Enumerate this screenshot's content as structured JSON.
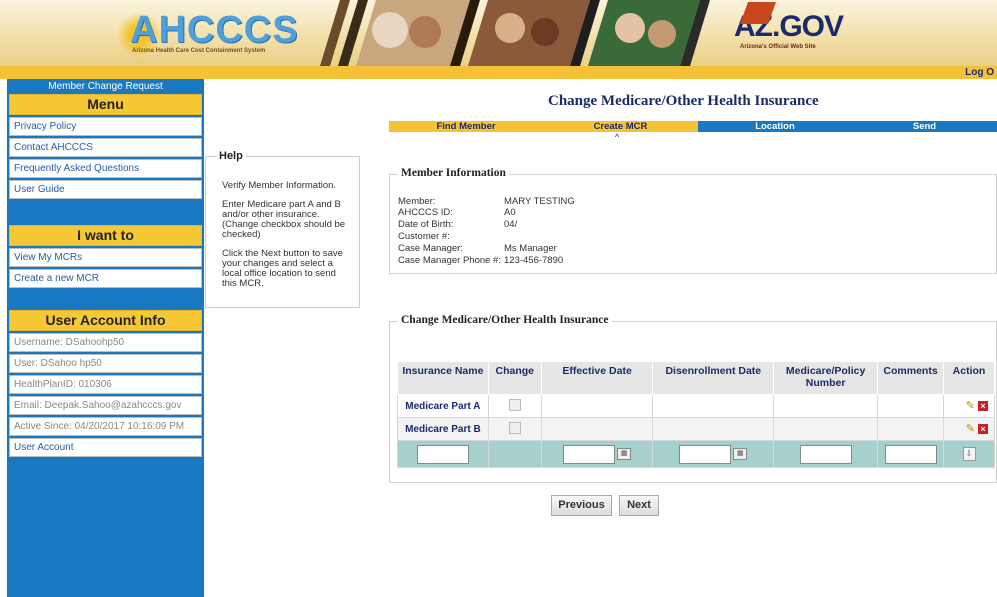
{
  "banner": {
    "logo_text": "AHCCCS",
    "logo_subtitle": "Arizona Health Care Cost Containment System",
    "az_logo_text": "AZ.GOV",
    "az_logo_subtitle": "Arizona's Official Web Site"
  },
  "topbar": {
    "logout": "Log O"
  },
  "sidebar": {
    "title": "Member Change Request",
    "menu_heading": "Menu",
    "menu_items": [
      {
        "label": "Privacy Policy"
      },
      {
        "label": "Contact AHCCCS"
      },
      {
        "label": "Frequently Asked Questions"
      },
      {
        "label": "User Guide"
      }
    ],
    "iwant_heading": "I want to",
    "iwant_items": [
      {
        "label": "View My MCRs"
      },
      {
        "label": "Create a new MCR"
      }
    ],
    "account_heading": "User Account Info",
    "account_items": [
      {
        "label": "Username: DSahoohp50"
      },
      {
        "label": "User: DSahoo hp50"
      },
      {
        "label": "HealthPlanID: 010306"
      },
      {
        "label": "Email: Deepak.Sahoo@azahcccs.gov"
      },
      {
        "label": "Active Since: 04/20/2017 10:16:09 PM"
      },
      {
        "label": "User Account"
      }
    ]
  },
  "help": {
    "title": "Help",
    "paragraphs": [
      "Verify Member Information.",
      "Enter Medicare part A and B and/or other insurance. (Change checkbox should be checked)",
      "Click the Next button to save your changes and select a local office location to send this MCR."
    ]
  },
  "page": {
    "title": "Change Medicare/Other Health Insurance"
  },
  "steps": [
    {
      "label": "Find Member",
      "color": "#f5c136",
      "text_color": "#1b2a6b"
    },
    {
      "label": "Create MCR",
      "color": "#f5c136",
      "text_color": "#1b2a6b"
    },
    {
      "label": "Location",
      "color": "#1a78c2",
      "text_color": "#ffffff"
    },
    {
      "label": "Send",
      "color": "#1a78c2",
      "text_color": "#ffffff"
    }
  ],
  "member_info": {
    "title": "Member Information",
    "rows": [
      {
        "label": "Member:",
        "value": "MARY TESTING"
      },
      {
        "label": "AHCCCS ID:",
        "value": "A0"
      },
      {
        "label": "Date of Birth:",
        "value": "04/"
      },
      {
        "label": "Customer #:",
        "value": ""
      },
      {
        "label": "Case Manager:",
        "value": "Ms Manager"
      },
      {
        "label": "Case Manager Phone #:",
        "value": "123-456-7890"
      }
    ]
  },
  "insurance": {
    "title": "Change Medicare/Other Health Insurance",
    "columns": [
      "Insurance Name",
      "Change",
      "Effective Date",
      "Disenrollment Date",
      "Medicare/Policy Number",
      "Comments",
      "Action"
    ],
    "rows": [
      {
        "name": "Medicare Part A",
        "effective": "",
        "disenrollment": "",
        "policy": "",
        "comments": ""
      },
      {
        "name": "Medicare Part B",
        "effective": "",
        "disenrollment": "",
        "policy": "",
        "comments": ""
      }
    ]
  },
  "buttons": {
    "previous": "Previous",
    "next": "Next"
  },
  "colors": {
    "brand_blue": "#1a78c2",
    "gold": "#f5c136",
    "navy": "#1b2a6b",
    "teal_row": "#a6d0cb"
  }
}
